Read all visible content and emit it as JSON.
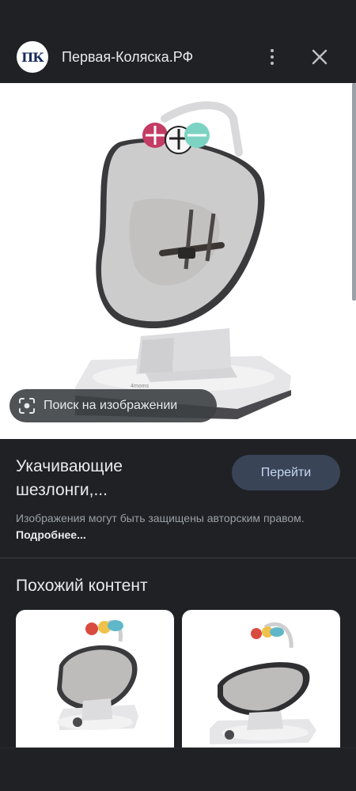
{
  "header": {
    "logo_text": "ПК",
    "site_name": "Первая-Коляска.РФ",
    "more_icon": "more-vert-icon",
    "close_icon": "close-icon"
  },
  "image": {
    "lens_chip_label": "Поиск на изображении",
    "lens_icon": "google-lens-icon",
    "product_logo_text": "4moms"
  },
  "result": {
    "title_line1": "Укачивающие",
    "title_line2": "шезлонги,...",
    "go_button_label": "Перейти",
    "copyright_text": "Изображения могут быть защищены авторским правом.",
    "more_link": "Подробнее..."
  },
  "similar": {
    "heading": "Похожий контент"
  },
  "colors": {
    "background": "#202124",
    "button_bg": "#394457",
    "button_text": "#c9d7f0"
  }
}
